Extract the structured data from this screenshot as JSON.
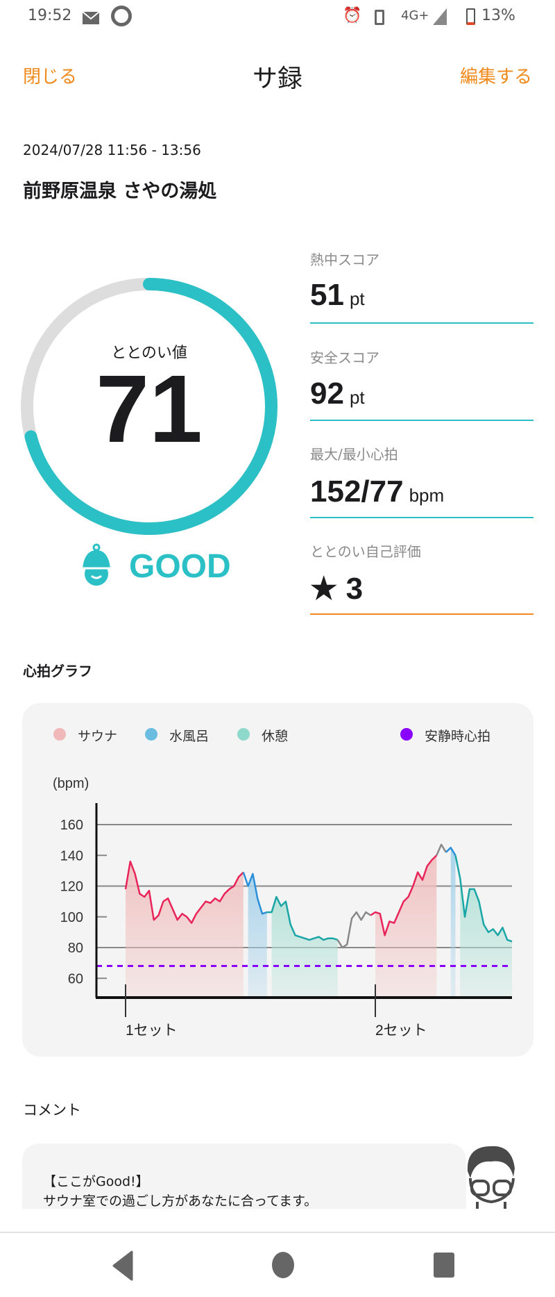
{
  "status_bar": {
    "time": "19:52",
    "network": "4G+",
    "battery": "13%",
    "icons": [
      "mail-icon",
      "docomo-d-icon",
      "alarm-icon",
      "vibrate-icon",
      "signal-icon",
      "battery-icon"
    ]
  },
  "header": {
    "close_label": "閉じる",
    "title": "サ録",
    "edit_label": "編集する"
  },
  "session": {
    "datetime": "2024/07/28 11:56 - 13:56",
    "venue": "前野原温泉 さやの湯処"
  },
  "gauge": {
    "label": "ととのい値",
    "value": "71",
    "progress_percent": 71,
    "rating": "GOOD",
    "color": "#2bbfc6",
    "track_color": "#dddddd"
  },
  "stats": [
    {
      "label": "熱中スコア",
      "value": "51",
      "unit": "pt"
    },
    {
      "label": "安全スコア",
      "value": "92",
      "unit": "pt"
    },
    {
      "label": "最大/最小心拍",
      "value": "152/77",
      "unit": "bpm"
    },
    {
      "label": "ととのい自己評価",
      "value": "★ 3",
      "unit": ""
    }
  ],
  "heart_graph": {
    "title": "心拍グラフ"
  },
  "chart_data": {
    "type": "area",
    "ylabel": "(bpm)",
    "yticks": [
      160,
      140,
      120,
      100,
      80,
      60
    ],
    "ylim": [
      48,
      174
    ],
    "xtick_labels": [
      "1セット",
      "2セット"
    ],
    "legend": [
      {
        "name": "サウナ",
        "color": "#f0b8b8"
      },
      {
        "name": "水風呂",
        "color": "#6bbde0"
      },
      {
        "name": "休憩",
        "color": "#8fd8cc"
      },
      {
        "name": "安静時心拍",
        "color": "#8a00ff"
      }
    ],
    "resting_hr": 68,
    "segments": [
      {
        "phase": "sauna",
        "set": 1,
        "values": [
          118,
          136,
          128,
          115,
          113,
          117,
          98,
          101,
          110,
          112,
          105,
          98,
          102,
          100,
          96,
          102,
          106,
          110,
          109,
          112,
          110,
          115,
          118,
          120,
          126,
          129
        ]
      },
      {
        "phase": "cold",
        "values": [
          120,
          128,
          112,
          102,
          103
        ]
      },
      {
        "phase": "rest",
        "values": [
          103,
          113,
          107,
          110,
          95,
          88,
          87,
          86,
          85,
          86,
          87,
          85,
          86,
          86,
          85
        ]
      },
      {
        "phase": "none",
        "values": [
          80,
          82,
          99,
          103,
          98,
          103,
          101
        ]
      },
      {
        "phase": "sauna",
        "set": 2,
        "values": [
          103,
          102,
          88,
          97,
          96,
          103,
          110,
          113,
          120,
          129,
          124,
          133,
          137,
          140
        ]
      },
      {
        "phase": "none",
        "values": [
          147,
          142
        ]
      },
      {
        "phase": "cold",
        "values": [
          145,
          140
        ]
      },
      {
        "phase": "rest",
        "values": [
          125,
          100,
          118,
          118,
          110,
          95,
          90,
          92,
          88,
          93,
          85,
          84
        ]
      }
    ]
  },
  "comment": {
    "title": "コメント",
    "heading": "【ここがGood!】",
    "body": "サウナ室での過ごし方があなたに合ってます。"
  },
  "nav": {
    "icons": [
      "back-icon",
      "home-icon",
      "recents-icon"
    ]
  }
}
